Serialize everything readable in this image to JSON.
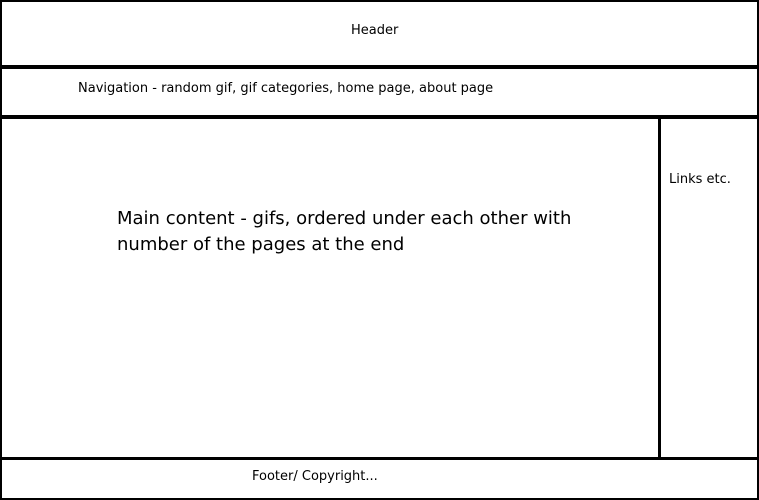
{
  "header": {
    "label": "Header"
  },
  "navigation": {
    "label": "Navigation - random gif, gif categories, home page, about page"
  },
  "main": {
    "label": "Main content - gifs, ordered under each other with number of the pages at the end"
  },
  "sidebar": {
    "label": "Links etc."
  },
  "footer": {
    "label": "Footer/ Copyright..."
  }
}
